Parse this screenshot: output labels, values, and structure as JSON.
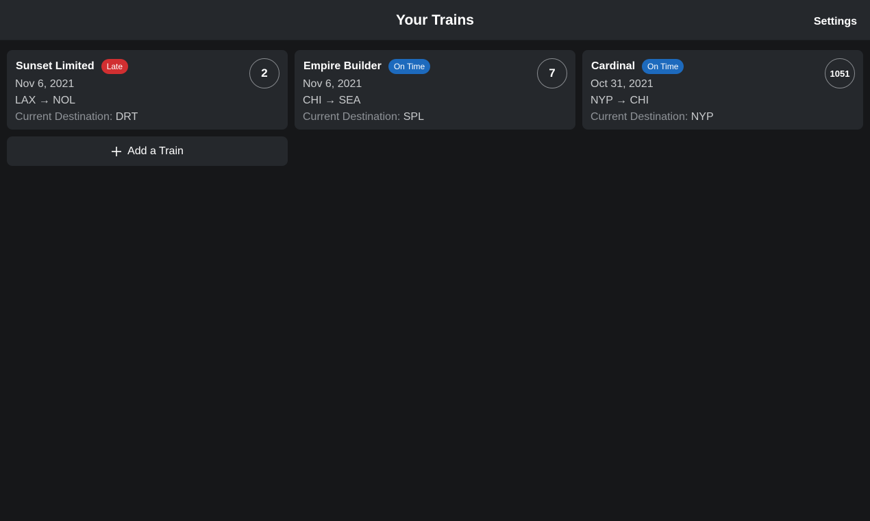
{
  "header": {
    "title": "Your Trains",
    "settings_label": "Settings"
  },
  "trains": [
    {
      "name": "Sunset Limited",
      "status": "Late",
      "status_color": "#d12f31",
      "number": "2",
      "date": "Nov 6, 2021",
      "route": "LAX → NOL",
      "destination_label": "Current Destination:",
      "destination": "DRT"
    },
    {
      "name": "Empire Builder",
      "status": "On Time",
      "status_color": "#1d6abd",
      "number": "7",
      "date": "Nov 6, 2021",
      "route": "CHI → SEA",
      "destination_label": "Current Destination:",
      "destination": "SPL"
    },
    {
      "name": "Cardinal",
      "status": "On Time",
      "status_color": "#1d6abd",
      "number": "1051",
      "date": "Oct 31, 2021",
      "route": "NYP → CHI",
      "destination_label": "Current Destination:",
      "destination": "NYP"
    }
  ],
  "add_train": {
    "label": "Add a Train",
    "icon": "plus-icon"
  }
}
